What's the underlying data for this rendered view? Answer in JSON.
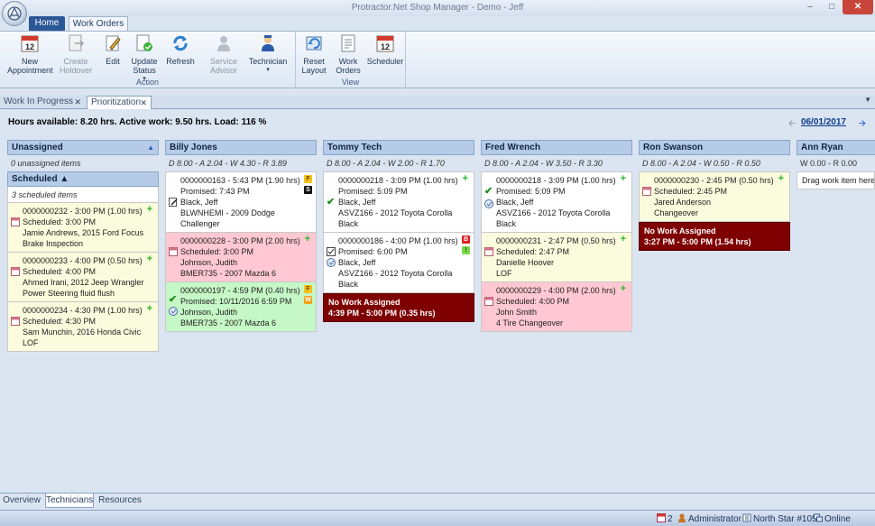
{
  "window": {
    "title": "Protractor.Net Shop Manager - Demo - Jeff"
  },
  "ribbon_tabs": [
    {
      "label": "Home"
    },
    {
      "label": "Work Orders"
    }
  ],
  "ribbon": {
    "action_group_label": "Action",
    "view_group_label": "View",
    "buttons": {
      "new_appointment": "New Appointment",
      "create_holdover": "Create Holdover",
      "edit": "Edit",
      "update_status": "Update Status",
      "refresh": "Refresh",
      "service_advisor": "Service Advisor",
      "technician": "Technician",
      "reset_layout": "Reset Layout",
      "work_orders": "Work Orders",
      "scheduler": "Scheduler"
    },
    "calendar_day": "12"
  },
  "doc_tabs": [
    {
      "label": "Work In Progress"
    },
    {
      "label": "Prioritization"
    }
  ],
  "summary": {
    "hours_text": "Hours available: 8.20 hrs. Active work: 9.50 hrs. Load: 116 %",
    "date": "06/01/2017"
  },
  "unassigned": {
    "header": "Unassigned",
    "sub": "0 unassigned items",
    "scheduled_header": "Scheduled",
    "scheduled_sub": "3 scheduled items",
    "items": [
      {
        "l1": "0000000232 - 3:00 PM (1.00 hrs)",
        "l2": "Scheduled: 3:00 PM",
        "l3": "Jamie Andrews, 2015 Ford Focus",
        "l4": "Brake Inspection"
      },
      {
        "l1": "0000000233 - 4:00 PM (0.50 hrs)",
        "l2": "Scheduled: 4:00 PM",
        "l3": "Ahmed Irani, 2012 Jeep Wrangler",
        "l4": "Power Steering fluid flush"
      },
      {
        "l1": "0000000234 - 4:30 PM (1.00 hrs)",
        "l2": "Scheduled: 4:30 PM",
        "l3": "Sam Munchin, 2016 Honda Civic",
        "l4": "LOF"
      }
    ]
  },
  "columns": [
    {
      "name": "Billy Jones",
      "hours": "D 8.00 - A 2.04 - W 4.30 - R 3.89",
      "cards": [
        {
          "l1": "0000000163 - 5:43 PM (1.90 hrs)",
          "l2": "Promised: 7:43 PM",
          "l3": "Black, Jeff",
          "l4": "BLWNHEMI -  2009 Dodge",
          "l5": "Challenger",
          "badge1": "F",
          "badge2": "S"
        },
        {
          "l1": "0000000228 - 3:00 PM (2.00 hrs)",
          "l2": "Scheduled: 3:00 PM",
          "l3": "Johnson, Judith",
          "l4": "BMER735 -  2007 Mazda 6"
        },
        {
          "l1": "0000000197 - 4:59 PM (0.40 hrs)",
          "l2": "Promised: 10/11/2016 6:59 PM",
          "l3": "Johnson, Judith",
          "l4": "BMER735 -  2007 Mazda 6",
          "badge1": "F",
          "badge2": "W"
        }
      ]
    },
    {
      "name": "Tommy Tech",
      "hours": "D 8.00 - A 2.04 - W 2.00 - R 1.70",
      "cards": [
        {
          "l1": "0000000218 - 3:09 PM (1.00 hrs)",
          "l2": "Promised: 5:09 PM",
          "l3": "Black, Jeff",
          "l4": "ASVZ166 -  2012 Toyota Corolla",
          "l5": "Black"
        },
        {
          "l1": "0000000186 - 4:00 PM (1.00 hrs)",
          "l2": "Promised: 6:00 PM",
          "l3": "Black, Jeff",
          "l4": "ASVZ166 -  2012 Toyota Corolla",
          "l5": "Black",
          "badge1": "B",
          "badge2": "!"
        }
      ],
      "nowork": {
        "l1": "No Work Assigned",
        "l2": "4:39 PM - 5:00 PM (0.35 hrs)"
      }
    },
    {
      "name": "Fred Wrench",
      "hours": "D 8.00 - A 2.04 - W 3.50 - R 3.30",
      "cards": [
        {
          "l1": "0000000218 - 3:09 PM (1.00 hrs)",
          "l2": "Promised: 5:09 PM",
          "l3": "Black, Jeff",
          "l4": "ASVZ166 -  2012 Toyota Corolla",
          "l5": "Black"
        },
        {
          "l1": "0000000231 - 2:47 PM (0.50 hrs)",
          "l2": "Scheduled: 2:47 PM",
          "l3": "Danielle Hoover",
          "l4": "LOF"
        },
        {
          "l1": "0000000229 - 4:00 PM (2.00 hrs)",
          "l2": "Scheduled: 4:00 PM",
          "l3": "John Smith",
          "l4": "4 Tire Changeover"
        }
      ]
    },
    {
      "name": "Ron Swanson",
      "hours": "D 8.00 - A 2.04 - W 0.50 - R 0.50",
      "cards": [
        {
          "l1": "0000000230 - 2:45 PM (0.50 hrs)",
          "l2": "Scheduled: 2:45 PM",
          "l3": "Jared Anderson",
          "l4": "Changeover"
        }
      ],
      "nowork": {
        "l1": "No Work Assigned",
        "l2": "3:27 PM - 5:00 PM (1.54 hrs)"
      }
    },
    {
      "name": "Ann Ryan",
      "hours": "W 0.00 - R 0.00",
      "placeholder": "Drag work item here"
    }
  ],
  "bottom_tabs": [
    {
      "label": "Overview"
    },
    {
      "label": "Technicians"
    },
    {
      "label": "Resources"
    }
  ],
  "status": {
    "count": "2",
    "user": "Administrator",
    "location": "North Star #105",
    "connection": "Online"
  },
  "colors": {
    "scheduled_card": "#fbfbdd",
    "late_card": "#ffc8d2",
    "done_card": "#c6f7c6",
    "no_work": "#7f0000",
    "header": "#b5cbe7"
  },
  "icons": [
    "app-orb-icon",
    "calendar-icon",
    "document-arrow-icon",
    "pencil-icon",
    "status-check-icon",
    "refresh-icon",
    "person-icon",
    "technician-icon",
    "reset-layout-icon",
    "work-orders-icon",
    "scheduler-icon",
    "plus-icon",
    "check-icon",
    "clock-icon",
    "date-icon"
  ]
}
